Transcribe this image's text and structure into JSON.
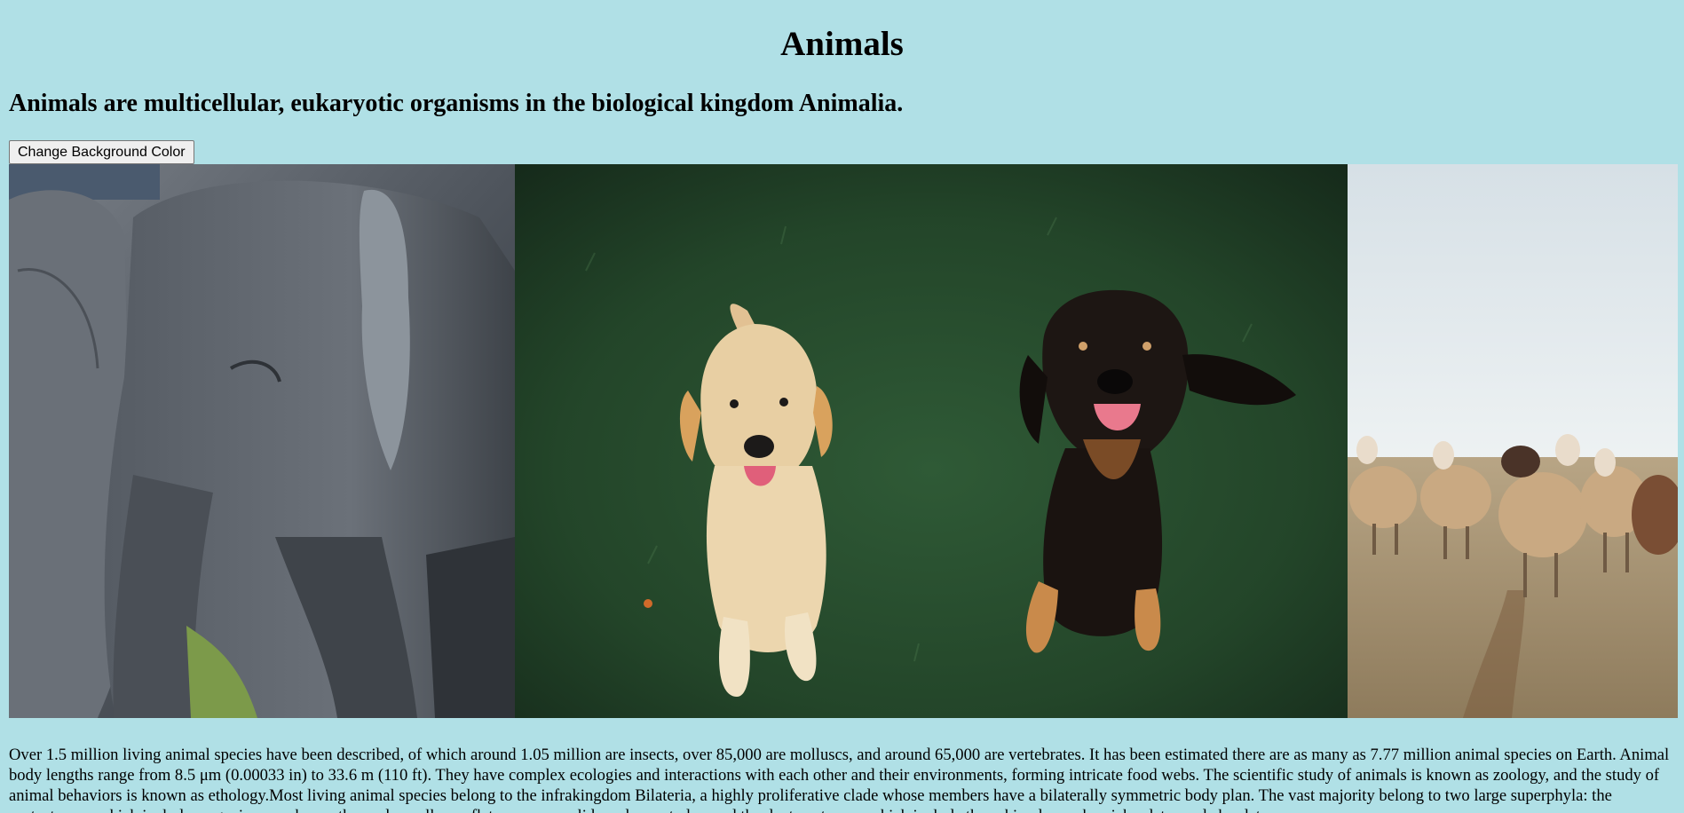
{
  "page": {
    "title": "Animals",
    "subtitle": "Animals are multicellular, eukaryotic organisms in the biological kingdom Animalia.",
    "button_label": "Change Background Color",
    "background_color": "#b0e0e6",
    "description": "Over 1.5 million living animal species have been described, of which around 1.05 million are insects, over 85,000 are molluscs, and around 65,000 are vertebrates. It has been estimated there are as many as 7.77 million animal species on Earth. Animal body lengths range from 8.5 μm (0.00033 in) to 33.6 m (110 ft). They have complex ecologies and interactions with each other and their environments, forming intricate food webs. The scientific study of animals is known as zoology, and the study of animal behaviors is known as ethology.Most living animal species belong to the infrakingdom Bilateria, a highly proliferative clade whose members have a bilaterally symmetric body plan. The vast majority belong to two large superphyla: the protostomes, which includes organisms such as arthropods, molluscs, flatworms, annelids and nematodes; and the deuterostomes, which include the echinoderms, hemichordates and chordates."
  },
  "gallery": {
    "images": [
      {
        "subject": "elephants"
      },
      {
        "subject": "two dogs on grass"
      },
      {
        "subject": "sheep flock in field"
      }
    ]
  }
}
